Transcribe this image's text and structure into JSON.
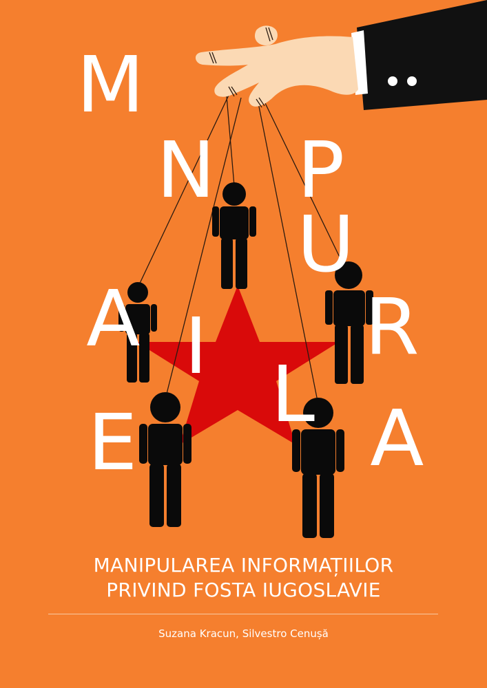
{
  "cover": {
    "background_color": "#f57f2e",
    "star_color": "#d90a0a",
    "figure_color": "#0a0a0a",
    "hand_color": "#fbd9b4",
    "sleeve_color": "#111111"
  },
  "scattered_letters": {
    "m": "M",
    "n": "N",
    "p": "P",
    "u": "U",
    "a1": "A",
    "r": "R",
    "i": "I",
    "l": "L",
    "e": "E",
    "a2": "A"
  },
  "title": {
    "line1": "MANIPULAREA INFORMAȚIILOR",
    "line2": "PRIVIND FOSTA IUGOSLAVIE"
  },
  "authors": "Suzana Kracun, Silvestro Cenușă"
}
